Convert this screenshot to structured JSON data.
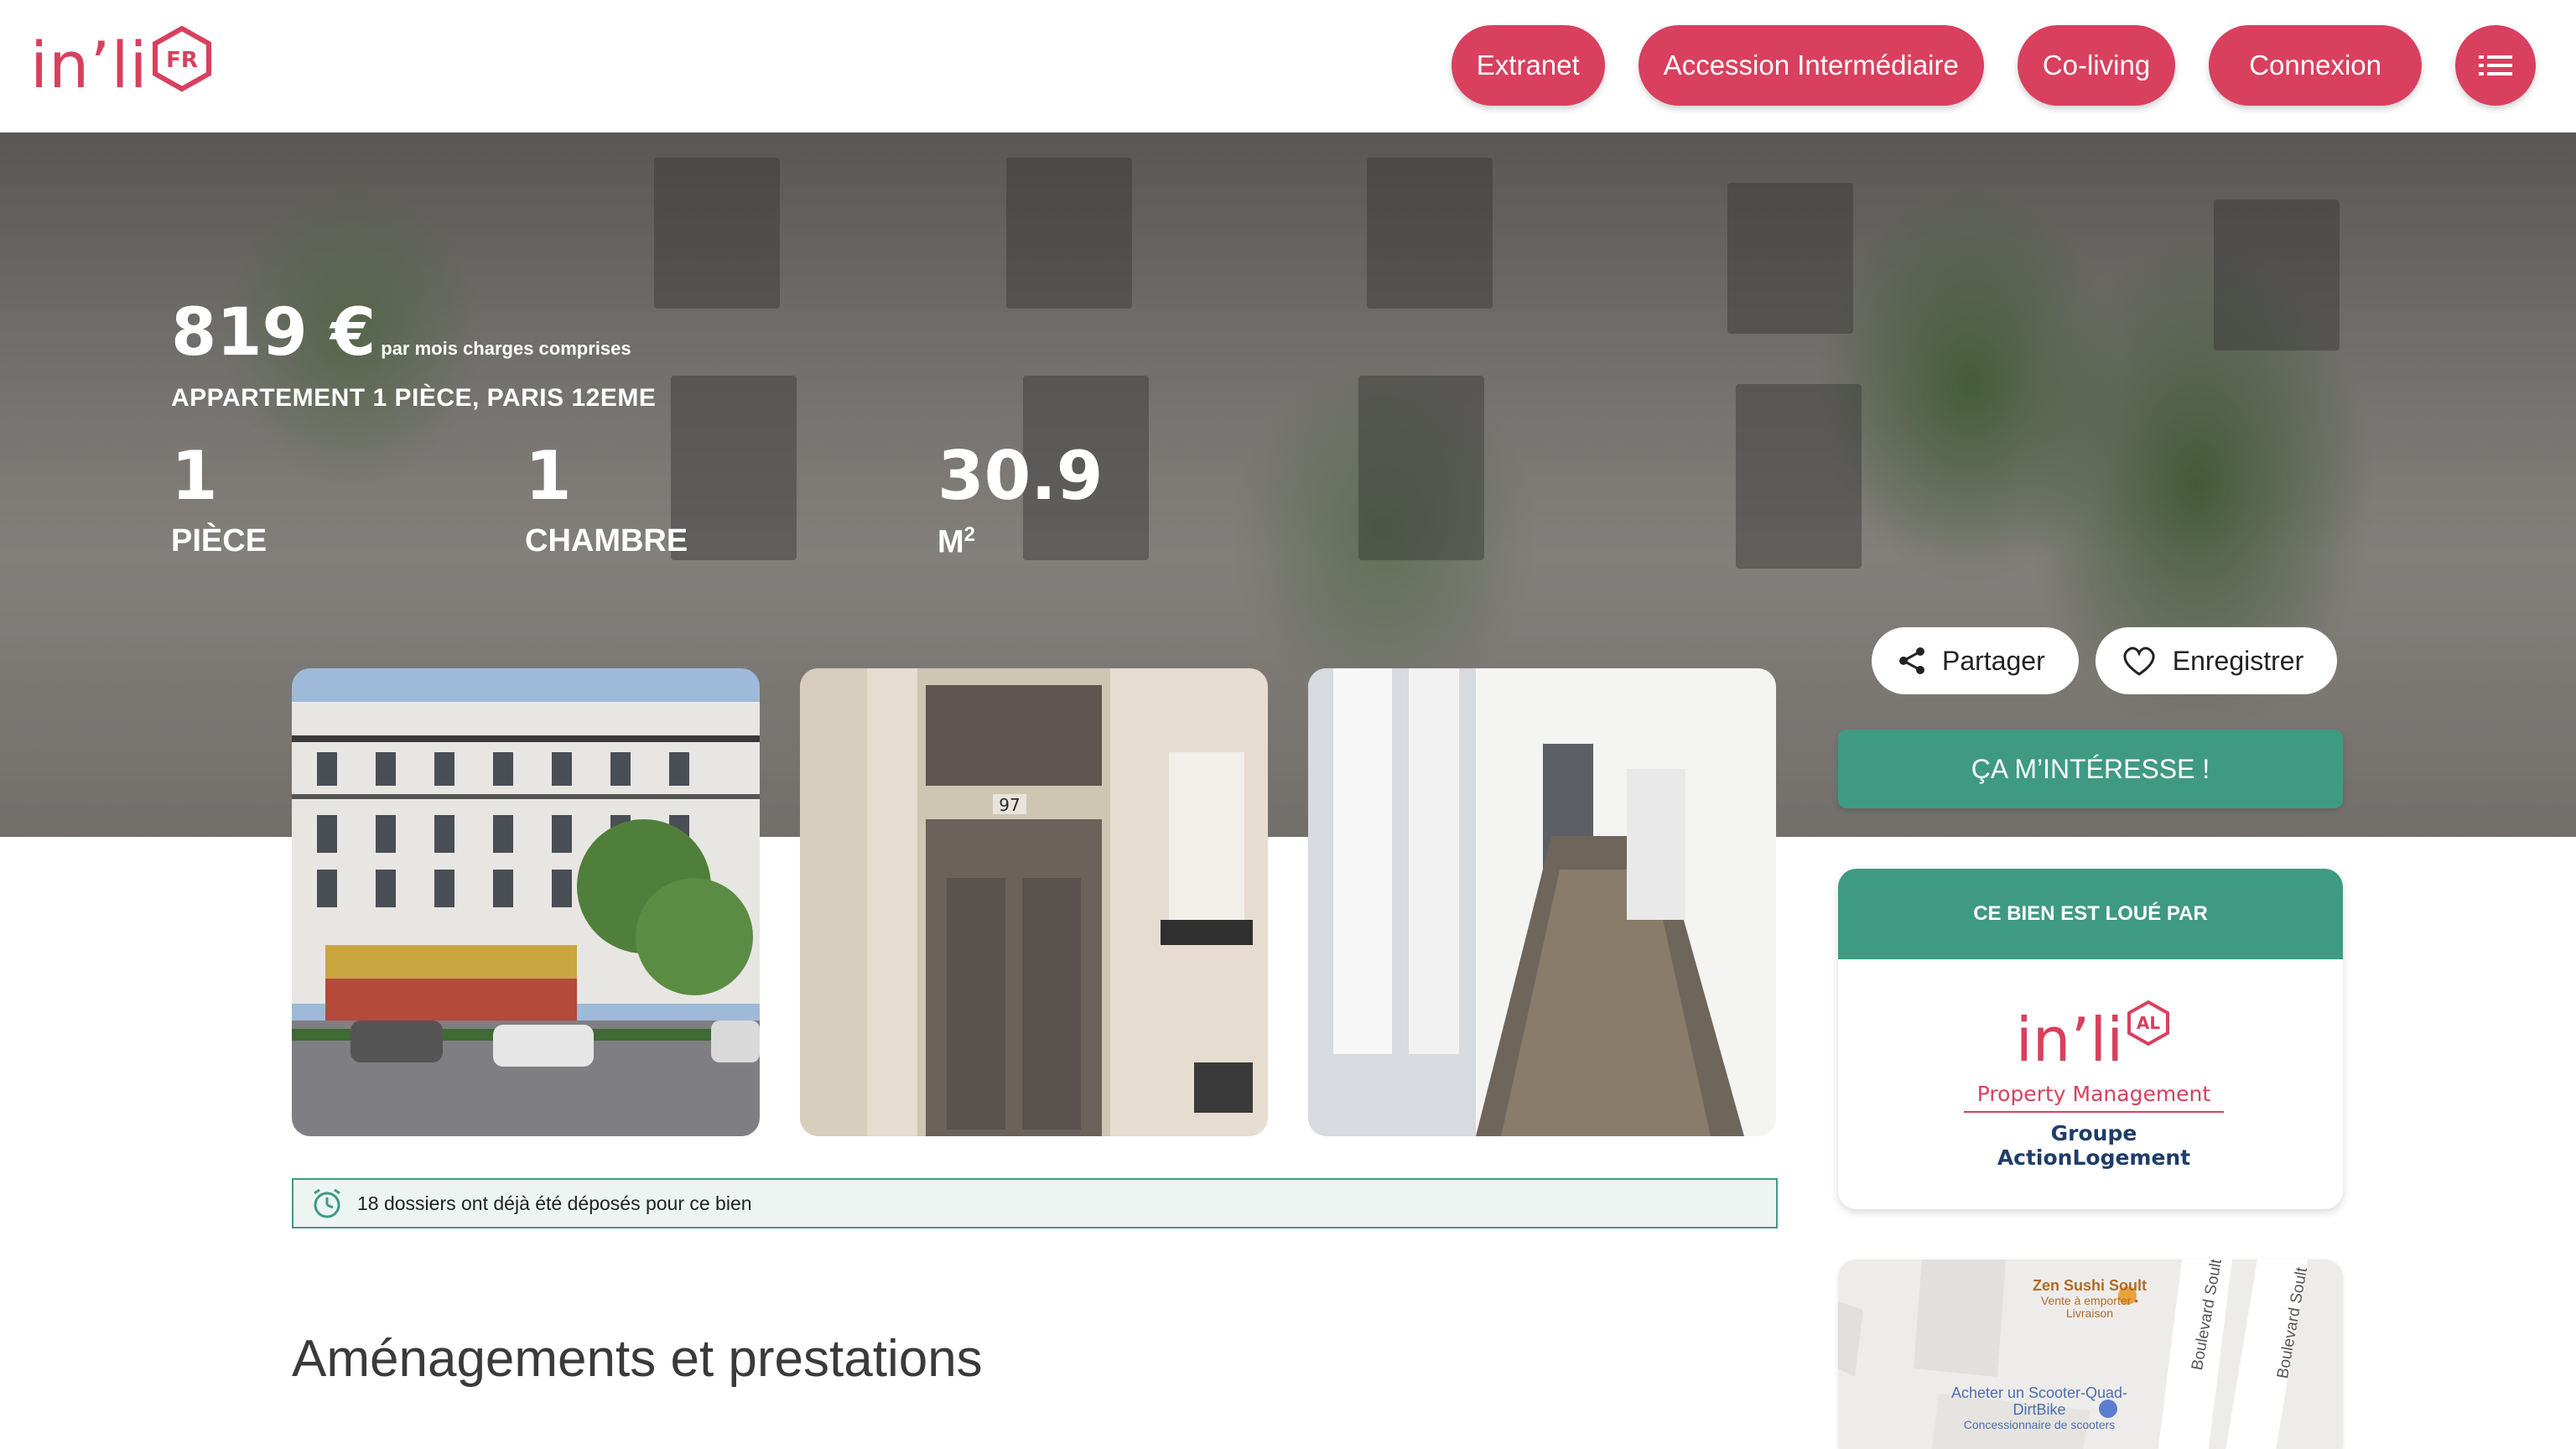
{
  "header": {
    "logo_text": "in’li",
    "logo_badge": "FR",
    "nav": [
      {
        "label": "Extranet"
      },
      {
        "label": "Accession Intermédiaire"
      },
      {
        "label": "Co-living"
      },
      {
        "label": "Connexion"
      }
    ],
    "menu_icon": "menu-lines-icon"
  },
  "listing": {
    "price": "819 €",
    "price_note": "par mois charges comprises",
    "subtitle": "APPARTEMENT 1 PIÈCE, PARIS 12EME",
    "stats": [
      {
        "value": "1",
        "label": "PIÈCE"
      },
      {
        "value": "1",
        "label": "CHAMBRE"
      },
      {
        "value": "30.9",
        "label": "M",
        "sup": "2"
      }
    ]
  },
  "actions": {
    "share_label": "Partager",
    "save_label": "Enregistrer"
  },
  "photos": [
    "building-facade",
    "entrance-door-97",
    "hallway"
  ],
  "photo_door_number": "97",
  "notice": {
    "text": "18 dossiers ont déjà été déposés pour ce bien",
    "icon": "alarm-clock-icon"
  },
  "section_title": "Aménagements et prestations",
  "sidebar": {
    "cta_label": "ÇA M’INTÉRESSE !",
    "agent_header": "CE BIEN EST LOUÉ PAR",
    "agent_logo_title": "in’li",
    "agent_logo_badge": "AL",
    "agent_logo_pm": "Property Management",
    "agent_logo_group": "Groupe ActionLogement"
  },
  "map": {
    "poi_1_name": "Zen Sushi Soult",
    "poi_1_sub": "Vente à emporter • Livraison",
    "poi_2_name": "Acheter un Scooter-Quad-DirtBike",
    "poi_2_sub": "Concessionnaire de scooters",
    "street_1": "Boulevard Soult",
    "street_2": "Boulevard Soult"
  },
  "colors": {
    "brand": "#d8405e",
    "accent_green": "#3f9a82",
    "notice_bg": "#edf5f2"
  }
}
